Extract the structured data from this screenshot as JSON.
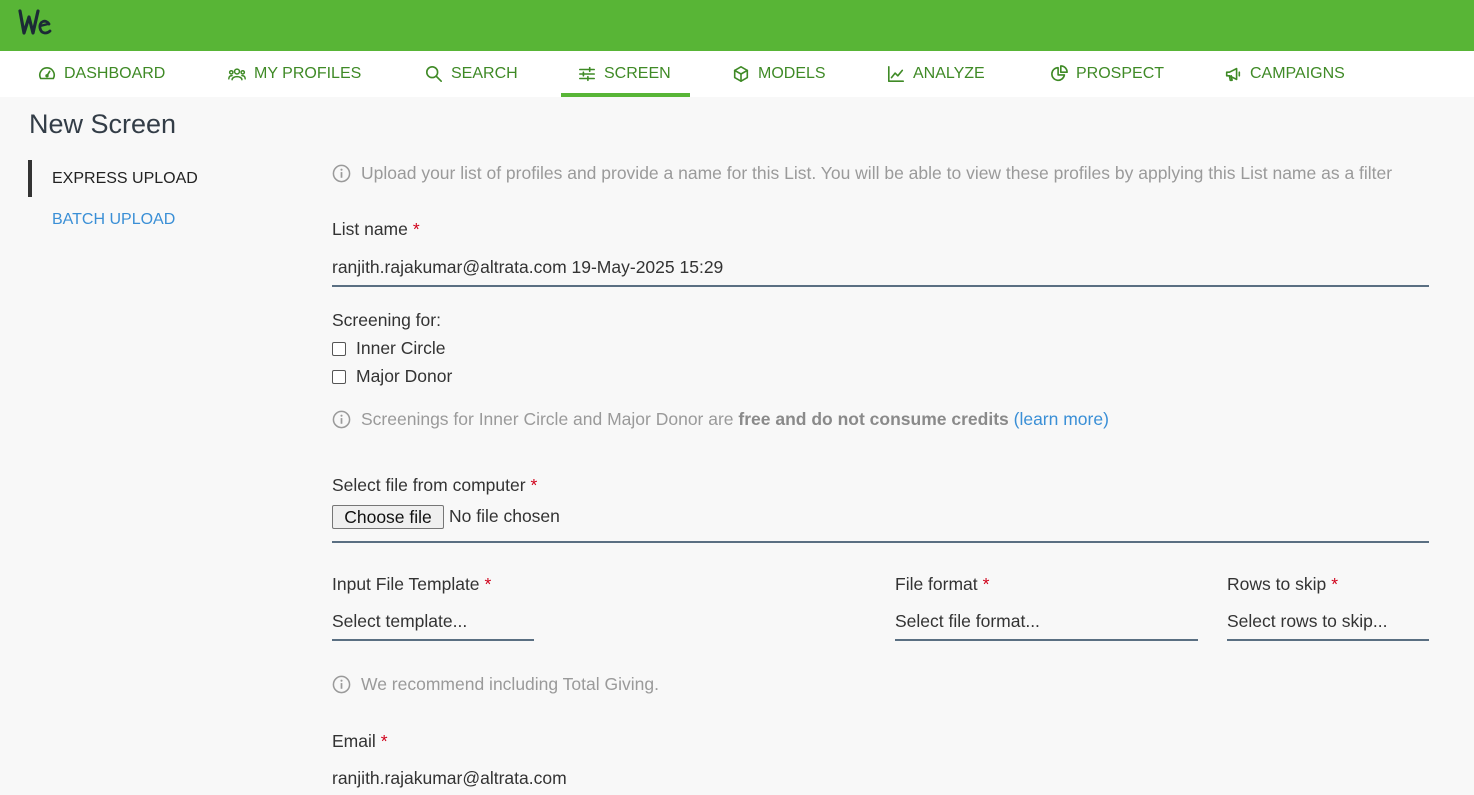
{
  "header": {
    "brand_color": "#58b536"
  },
  "nav": {
    "items": [
      {
        "label": "DASHBOARD",
        "icon": "dashboard-gauge-icon"
      },
      {
        "label": "MY PROFILES",
        "icon": "users-icon"
      },
      {
        "label": "SEARCH",
        "icon": "search-icon"
      },
      {
        "label": "SCREEN",
        "icon": "sliders-icon",
        "active": true
      },
      {
        "label": "MODELS",
        "icon": "cube-icon"
      },
      {
        "label": "ANALYZE",
        "icon": "line-chart-icon"
      },
      {
        "label": "PROSPECT",
        "icon": "pie-chart-icon"
      },
      {
        "label": "CAMPAIGNS",
        "icon": "megaphone-icon"
      }
    ],
    "text_color": "#3f8a26"
  },
  "page": {
    "title": "New Screen"
  },
  "sidebar": {
    "express_upload": "EXPRESS UPLOAD",
    "batch_upload": "BATCH UPLOAD"
  },
  "form": {
    "info_upload": "Upload your list of profiles and provide a name for this List. You will be able to view these profiles by applying this List name as a filter",
    "list_name_label": "List name",
    "list_name_value": "ranjith.rajakumar@altrata.com 19-May-2025 15:29",
    "screening_label": "Screening for:",
    "inner_circle": "Inner Circle",
    "major_donor": "Major Donor",
    "screening_info_prefix": "Screenings for Inner Circle and Major Donor are",
    "screening_info_bold": "free and do not consume credits",
    "learn_more": "(learn more)",
    "file_label": "Select file from computer",
    "choose_file": "Choose file",
    "no_file": "No file chosen",
    "template_label": "Input File Template",
    "template_placeholder": "Select template...",
    "format_label": "File format",
    "format_placeholder": "Select file format...",
    "rows_label": "Rows to skip",
    "rows_placeholder": "Select rows to skip...",
    "recommend_info": "We recommend including Total Giving.",
    "email_label": "Email",
    "email_value": "ranjith.rajakumar@altrata.com",
    "required_mark": "*"
  }
}
